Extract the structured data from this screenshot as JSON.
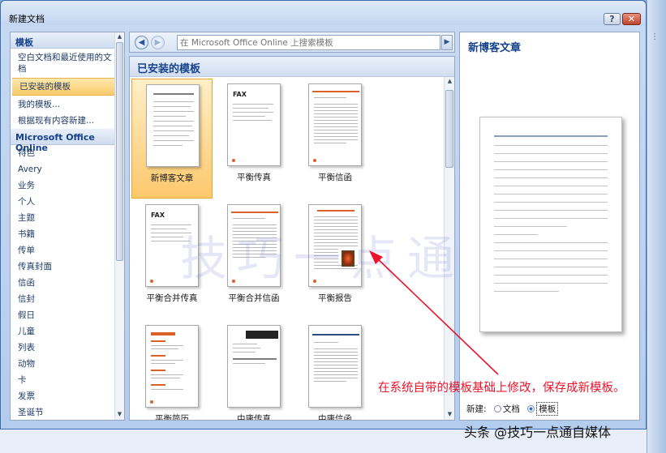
{
  "window": {
    "title": "新建文档",
    "help_label": "?",
    "close_label": "✕"
  },
  "left_panel": {
    "section_templates": "模板",
    "items_top": [
      {
        "label": "空白文档和最近使用的文档",
        "selected": false
      },
      {
        "label": "已安装的模板",
        "selected": true
      },
      {
        "label": "我的模板...",
        "selected": false
      },
      {
        "label": "根据现有内容新建...",
        "selected": false
      }
    ],
    "section_online": "Microsoft Office Online",
    "items_online": [
      "特色",
      "Avery",
      "业务",
      "个人",
      "主题",
      "书籍",
      "传单",
      "传真封面",
      "信函",
      "信封",
      "假日",
      "儿童",
      "列表",
      "动物",
      "卡",
      "发票",
      "圣诞节"
    ]
  },
  "search": {
    "placeholder": "在 Microsoft Office Online 上搜索模板",
    "back_icon": "back-arrow-icon",
    "forward_icon": "forward-arrow-icon",
    "go_icon": "go-arrow-icon"
  },
  "center": {
    "heading": "已安装的模板",
    "templates": [
      {
        "label": "新博客文章",
        "selected": true
      },
      {
        "label": "平衡传真",
        "selected": false
      },
      {
        "label": "平衡信函",
        "selected": false
      },
      {
        "label": "平衡合并传真",
        "selected": false
      },
      {
        "label": "平衡合并信函",
        "selected": false
      },
      {
        "label": "平衡报告",
        "selected": false
      },
      {
        "label": "平衡简历",
        "selected": false
      },
      {
        "label": "中庸传真",
        "selected": false
      },
      {
        "label": "中庸信函",
        "selected": false
      }
    ],
    "fax_text": "FAX"
  },
  "right_panel": {
    "title": "新博客文章",
    "new_label": "新建:",
    "option_document": "文档",
    "option_template": "模板",
    "selected_option": "模板"
  },
  "annotation": {
    "text": "在系统自带的模板基础上修改，保存成新模板。",
    "color": "#e8162c"
  },
  "watermark": "技巧一点通",
  "credit": "头条 @技巧一点通自媒体",
  "colors": {
    "accent": "#15428b",
    "selection": "#fbcb6b",
    "frame": "#3b6cb0"
  }
}
